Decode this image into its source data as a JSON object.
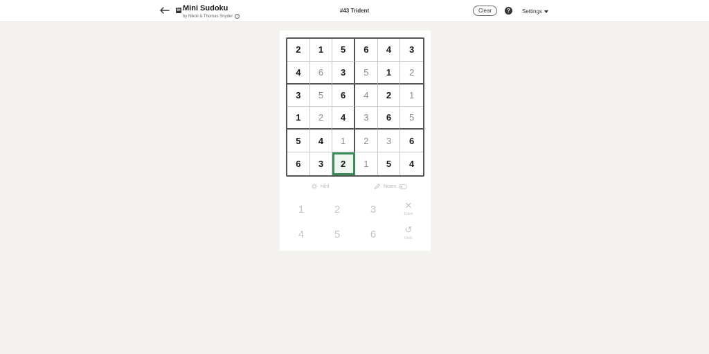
{
  "header": {
    "back_icon": "arrow-left-icon",
    "logo_text": "in",
    "title": "Mini Sudoku",
    "byline": "by Nikoli & Thomas Snyder",
    "info_icon_glyph": "i",
    "puzzle_title": "#43 Trident",
    "clear_label": "Clear",
    "help_glyph": "?",
    "settings_label": "Settings"
  },
  "grid": {
    "rows": [
      [
        {
          "v": "2",
          "t": "given"
        },
        {
          "v": "1",
          "t": "given"
        },
        {
          "v": "5",
          "t": "given"
        },
        {
          "v": "6",
          "t": "given"
        },
        {
          "v": "4",
          "t": "given"
        },
        {
          "v": "3",
          "t": "given"
        }
      ],
      [
        {
          "v": "4",
          "t": "given"
        },
        {
          "v": "6",
          "t": "entered"
        },
        {
          "v": "3",
          "t": "given"
        },
        {
          "v": "5",
          "t": "entered"
        },
        {
          "v": "1",
          "t": "given"
        },
        {
          "v": "2",
          "t": "entered"
        }
      ],
      [
        {
          "v": "3",
          "t": "given"
        },
        {
          "v": "5",
          "t": "entered"
        },
        {
          "v": "6",
          "t": "given"
        },
        {
          "v": "4",
          "t": "entered"
        },
        {
          "v": "2",
          "t": "given"
        },
        {
          "v": "1",
          "t": "entered"
        }
      ],
      [
        {
          "v": "1",
          "t": "given"
        },
        {
          "v": "2",
          "t": "entered"
        },
        {
          "v": "4",
          "t": "given"
        },
        {
          "v": "3",
          "t": "entered"
        },
        {
          "v": "6",
          "t": "given"
        },
        {
          "v": "5",
          "t": "entered"
        }
      ],
      [
        {
          "v": "5",
          "t": "given"
        },
        {
          "v": "4",
          "t": "given"
        },
        {
          "v": "1",
          "t": "entered"
        },
        {
          "v": "2",
          "t": "entered"
        },
        {
          "v": "3",
          "t": "entered"
        },
        {
          "v": "6",
          "t": "given"
        }
      ],
      [
        {
          "v": "6",
          "t": "given"
        },
        {
          "v": "3",
          "t": "given"
        },
        {
          "v": "2",
          "t": "selected"
        },
        {
          "v": "1",
          "t": "entered"
        },
        {
          "v": "5",
          "t": "given"
        },
        {
          "v": "4",
          "t": "given"
        }
      ]
    ],
    "selected_cell": [
      6,
      3
    ]
  },
  "tools": {
    "hint_label": "Hint",
    "hint_icon": "lightbulb-icon",
    "notes_label": "Notes",
    "notes_icon": "pencil-icon",
    "notes_toggle": "off"
  },
  "keypad": {
    "numbers": [
      "1",
      "2",
      "3",
      "4",
      "5",
      "6"
    ],
    "erase_label": "Erase",
    "erase_glyph": "✕",
    "undo_label": "Undo",
    "undo_glyph": "↺"
  },
  "colors": {
    "background": "#f3f2ef",
    "selected_border": "#3a8a5a",
    "selected_fill": "#eef7f0",
    "given_text": "#191919",
    "entered_text": "#8c8c8c",
    "disabled": "#c4c4c4"
  }
}
